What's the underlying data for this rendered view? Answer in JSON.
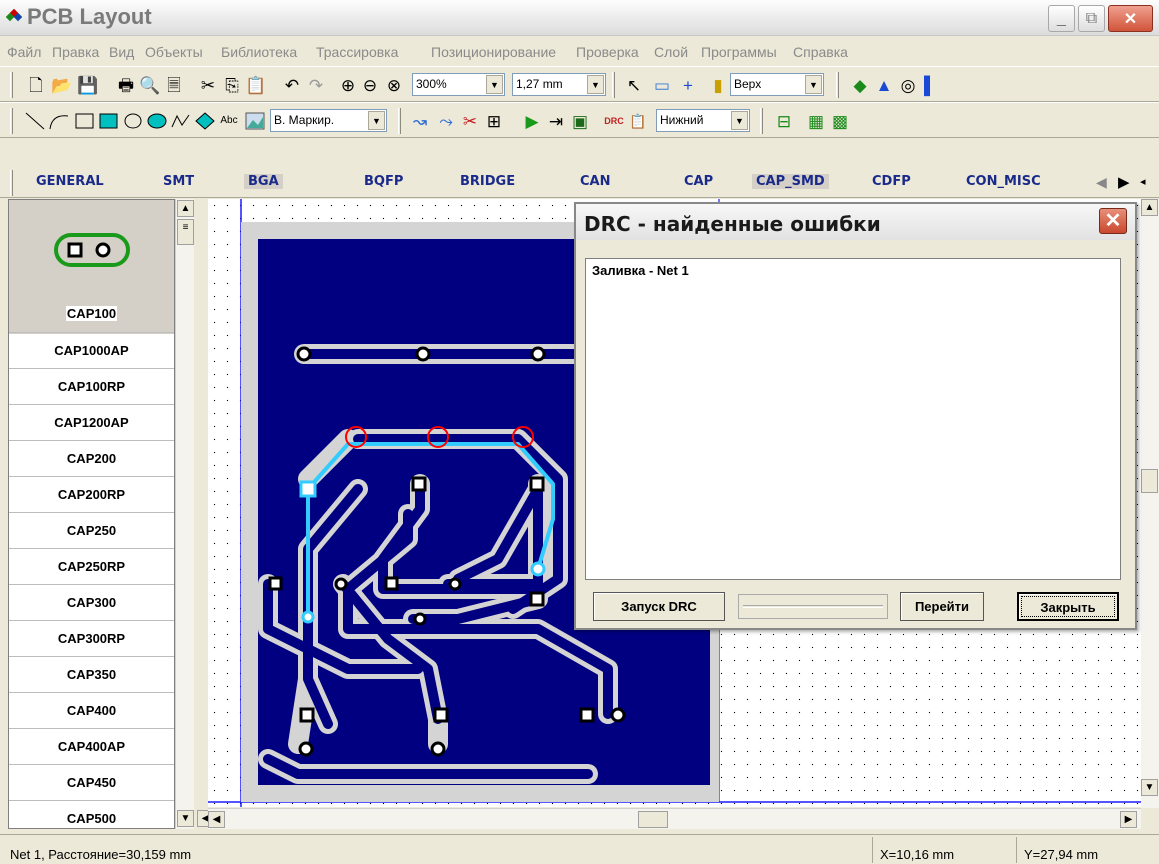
{
  "window": {
    "title": "PCB Layout",
    "minimize_label": "_",
    "maximize_label": "⧉",
    "close_label": "✕"
  },
  "menu": [
    "Файл",
    "Правка",
    "Вид",
    "Объекты",
    "Библиотека",
    "Трассировка",
    "Позиционирование",
    "Проверка",
    "Слой",
    "Программы",
    "Справка"
  ],
  "toolbar1": {
    "zoom_value": "300%",
    "grid_value": "1,27 mm",
    "layer_value": "Верх"
  },
  "toolbar2": {
    "text_icon": "Abc",
    "marking_value": "В. Маркир.",
    "bottom_layer_value": "Нижний",
    "drc_icon": "DRC"
  },
  "libtabs": [
    "GENERAL",
    "SMT",
    "BGA",
    "BQFP",
    "BRIDGE",
    "CAN",
    "CAP",
    "CAP_SMD",
    "CDFP",
    "CON_MISC"
  ],
  "components": [
    "CAP100",
    "CAP1000AP",
    "CAP100RP",
    "CAP1200AP",
    "CAP200",
    "CAP200RP",
    "CAP250",
    "CAP250RP",
    "CAP300",
    "CAP300RP",
    "CAP350",
    "CAP400",
    "CAP400AP",
    "CAP450",
    "CAP500"
  ],
  "dialog": {
    "title": "DRC - найденные ошибки",
    "errors": [
      "Заливка - Net 1"
    ],
    "run_button": "Запуск DRC",
    "goto_button": "Перейти",
    "close_button": "Закрыть"
  },
  "status": {
    "net_info": "Net 1, Расстояние=30,159 mm",
    "x": "X=10,16 mm",
    "y": "Y=27,94 mm"
  },
  "colors": {
    "board": "#000080",
    "trace": "#d4d4d4",
    "selected_trace": "#33ccff",
    "error_marker": "#ff0000"
  }
}
